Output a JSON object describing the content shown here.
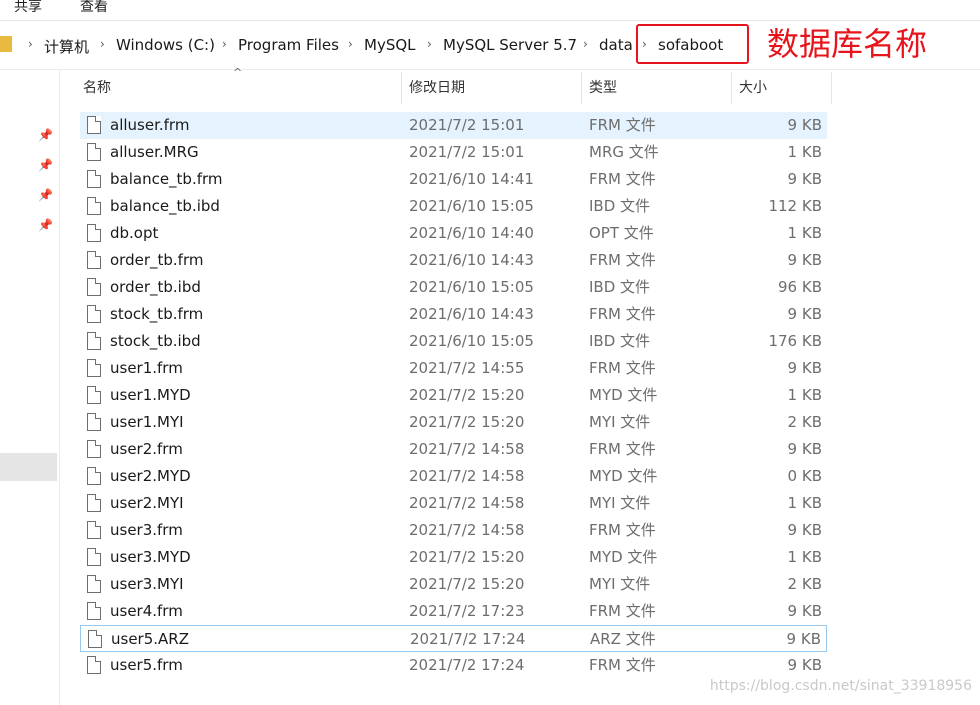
{
  "ribbon": {
    "tabs": [
      "共享",
      "查看"
    ]
  },
  "breadcrumb": [
    "计算机",
    "Windows (C:)",
    "Program Files",
    "MySQL",
    "MySQL Server 5.7",
    "data",
    "sofaboot"
  ],
  "annotation": "数据库名称",
  "columns": {
    "name": "名称",
    "date": "修改日期",
    "type": "类型",
    "size": "大小"
  },
  "files": [
    {
      "name": "alluser.frm",
      "date": "2021/7/2 15:01",
      "type": "FRM 文件",
      "size": "9 KB"
    },
    {
      "name": "alluser.MRG",
      "date": "2021/7/2 15:01",
      "type": "MRG 文件",
      "size": "1 KB"
    },
    {
      "name": "balance_tb.frm",
      "date": "2021/6/10 14:41",
      "type": "FRM 文件",
      "size": "9 KB"
    },
    {
      "name": "balance_tb.ibd",
      "date": "2021/6/10 15:05",
      "type": "IBD 文件",
      "size": "112 KB"
    },
    {
      "name": "db.opt",
      "date": "2021/6/10 14:40",
      "type": "OPT 文件",
      "size": "1 KB"
    },
    {
      "name": "order_tb.frm",
      "date": "2021/6/10 14:43",
      "type": "FRM 文件",
      "size": "9 KB"
    },
    {
      "name": "order_tb.ibd",
      "date": "2021/6/10 15:05",
      "type": "IBD 文件",
      "size": "96 KB"
    },
    {
      "name": "stock_tb.frm",
      "date": "2021/6/10 14:43",
      "type": "FRM 文件",
      "size": "9 KB"
    },
    {
      "name": "stock_tb.ibd",
      "date": "2021/6/10 15:05",
      "type": "IBD 文件",
      "size": "176 KB"
    },
    {
      "name": "user1.frm",
      "date": "2021/7/2 14:55",
      "type": "FRM 文件",
      "size": "9 KB"
    },
    {
      "name": "user1.MYD",
      "date": "2021/7/2 15:20",
      "type": "MYD 文件",
      "size": "1 KB"
    },
    {
      "name": "user1.MYI",
      "date": "2021/7/2 15:20",
      "type": "MYI 文件",
      "size": "2 KB"
    },
    {
      "name": "user2.frm",
      "date": "2021/7/2 14:58",
      "type": "FRM 文件",
      "size": "9 KB"
    },
    {
      "name": "user2.MYD",
      "date": "2021/7/2 14:58",
      "type": "MYD 文件",
      "size": "0 KB"
    },
    {
      "name": "user2.MYI",
      "date": "2021/7/2 14:58",
      "type": "MYI 文件",
      "size": "1 KB"
    },
    {
      "name": "user3.frm",
      "date": "2021/7/2 14:58",
      "type": "FRM 文件",
      "size": "9 KB"
    },
    {
      "name": "user3.MYD",
      "date": "2021/7/2 15:20",
      "type": "MYD 文件",
      "size": "1 KB"
    },
    {
      "name": "user3.MYI",
      "date": "2021/7/2 15:20",
      "type": "MYI 文件",
      "size": "2 KB"
    },
    {
      "name": "user4.frm",
      "date": "2021/7/2 17:23",
      "type": "FRM 文件",
      "size": "9 KB"
    },
    {
      "name": "user5.ARZ",
      "date": "2021/7/2 17:24",
      "type": "ARZ 文件",
      "size": "9 KB"
    },
    {
      "name": "user5.frm",
      "date": "2021/7/2 17:24",
      "type": "FRM 文件",
      "size": "9 KB"
    }
  ],
  "watermark": "https://blog.csdn.net/sinat_33918956"
}
